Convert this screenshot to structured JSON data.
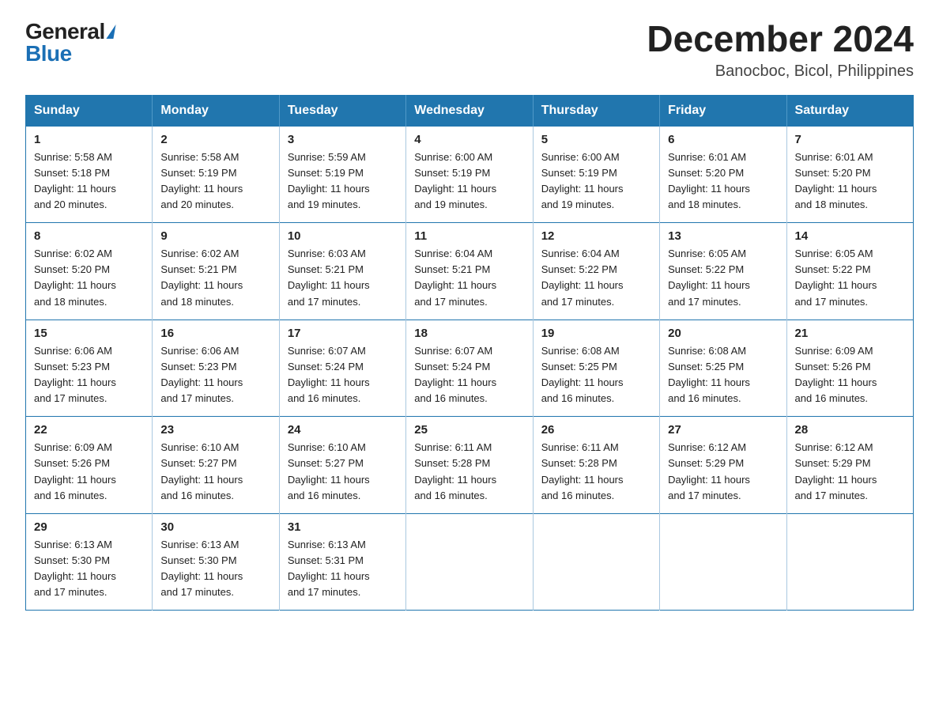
{
  "logo": {
    "general": "General",
    "blue": "Blue"
  },
  "header": {
    "month_year": "December 2024",
    "location": "Banocboc, Bicol, Philippines"
  },
  "weekdays": [
    "Sunday",
    "Monday",
    "Tuesday",
    "Wednesday",
    "Thursday",
    "Friday",
    "Saturday"
  ],
  "weeks": [
    [
      {
        "day": "1",
        "sunrise": "5:58 AM",
        "sunset": "5:18 PM",
        "daylight": "11 hours and 20 minutes."
      },
      {
        "day": "2",
        "sunrise": "5:58 AM",
        "sunset": "5:19 PM",
        "daylight": "11 hours and 20 minutes."
      },
      {
        "day": "3",
        "sunrise": "5:59 AM",
        "sunset": "5:19 PM",
        "daylight": "11 hours and 19 minutes."
      },
      {
        "day": "4",
        "sunrise": "6:00 AM",
        "sunset": "5:19 PM",
        "daylight": "11 hours and 19 minutes."
      },
      {
        "day": "5",
        "sunrise": "6:00 AM",
        "sunset": "5:19 PM",
        "daylight": "11 hours and 19 minutes."
      },
      {
        "day": "6",
        "sunrise": "6:01 AM",
        "sunset": "5:20 PM",
        "daylight": "11 hours and 18 minutes."
      },
      {
        "day": "7",
        "sunrise": "6:01 AM",
        "sunset": "5:20 PM",
        "daylight": "11 hours and 18 minutes."
      }
    ],
    [
      {
        "day": "8",
        "sunrise": "6:02 AM",
        "sunset": "5:20 PM",
        "daylight": "11 hours and 18 minutes."
      },
      {
        "day": "9",
        "sunrise": "6:02 AM",
        "sunset": "5:21 PM",
        "daylight": "11 hours and 18 minutes."
      },
      {
        "day": "10",
        "sunrise": "6:03 AM",
        "sunset": "5:21 PM",
        "daylight": "11 hours and 17 minutes."
      },
      {
        "day": "11",
        "sunrise": "6:04 AM",
        "sunset": "5:21 PM",
        "daylight": "11 hours and 17 minutes."
      },
      {
        "day": "12",
        "sunrise": "6:04 AM",
        "sunset": "5:22 PM",
        "daylight": "11 hours and 17 minutes."
      },
      {
        "day": "13",
        "sunrise": "6:05 AM",
        "sunset": "5:22 PM",
        "daylight": "11 hours and 17 minutes."
      },
      {
        "day": "14",
        "sunrise": "6:05 AM",
        "sunset": "5:22 PM",
        "daylight": "11 hours and 17 minutes."
      }
    ],
    [
      {
        "day": "15",
        "sunrise": "6:06 AM",
        "sunset": "5:23 PM",
        "daylight": "11 hours and 17 minutes."
      },
      {
        "day": "16",
        "sunrise": "6:06 AM",
        "sunset": "5:23 PM",
        "daylight": "11 hours and 17 minutes."
      },
      {
        "day": "17",
        "sunrise": "6:07 AM",
        "sunset": "5:24 PM",
        "daylight": "11 hours and 16 minutes."
      },
      {
        "day": "18",
        "sunrise": "6:07 AM",
        "sunset": "5:24 PM",
        "daylight": "11 hours and 16 minutes."
      },
      {
        "day": "19",
        "sunrise": "6:08 AM",
        "sunset": "5:25 PM",
        "daylight": "11 hours and 16 minutes."
      },
      {
        "day": "20",
        "sunrise": "6:08 AM",
        "sunset": "5:25 PM",
        "daylight": "11 hours and 16 minutes."
      },
      {
        "day": "21",
        "sunrise": "6:09 AM",
        "sunset": "5:26 PM",
        "daylight": "11 hours and 16 minutes."
      }
    ],
    [
      {
        "day": "22",
        "sunrise": "6:09 AM",
        "sunset": "5:26 PM",
        "daylight": "11 hours and 16 minutes."
      },
      {
        "day": "23",
        "sunrise": "6:10 AM",
        "sunset": "5:27 PM",
        "daylight": "11 hours and 16 minutes."
      },
      {
        "day": "24",
        "sunrise": "6:10 AM",
        "sunset": "5:27 PM",
        "daylight": "11 hours and 16 minutes."
      },
      {
        "day": "25",
        "sunrise": "6:11 AM",
        "sunset": "5:28 PM",
        "daylight": "11 hours and 16 minutes."
      },
      {
        "day": "26",
        "sunrise": "6:11 AM",
        "sunset": "5:28 PM",
        "daylight": "11 hours and 16 minutes."
      },
      {
        "day": "27",
        "sunrise": "6:12 AM",
        "sunset": "5:29 PM",
        "daylight": "11 hours and 17 minutes."
      },
      {
        "day": "28",
        "sunrise": "6:12 AM",
        "sunset": "5:29 PM",
        "daylight": "11 hours and 17 minutes."
      }
    ],
    [
      {
        "day": "29",
        "sunrise": "6:13 AM",
        "sunset": "5:30 PM",
        "daylight": "11 hours and 17 minutes."
      },
      {
        "day": "30",
        "sunrise": "6:13 AM",
        "sunset": "5:30 PM",
        "daylight": "11 hours and 17 minutes."
      },
      {
        "day": "31",
        "sunrise": "6:13 AM",
        "sunset": "5:31 PM",
        "daylight": "11 hours and 17 minutes."
      },
      null,
      null,
      null,
      null
    ]
  ],
  "labels": {
    "sunrise": "Sunrise: ",
    "sunset": "Sunset: ",
    "daylight": "Daylight: "
  }
}
